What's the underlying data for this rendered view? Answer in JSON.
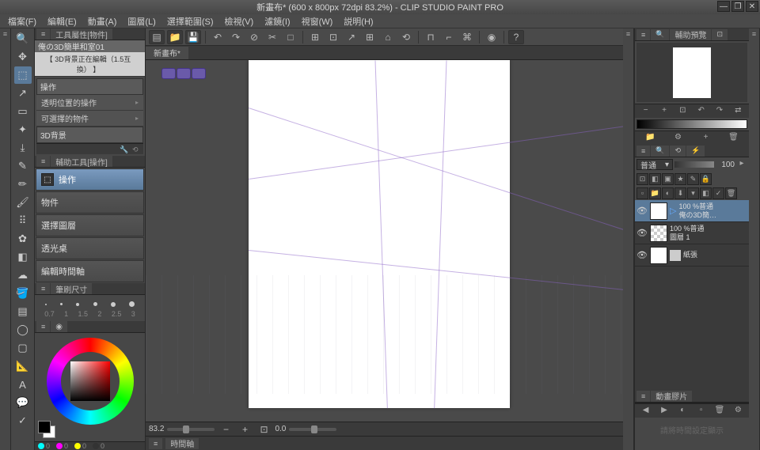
{
  "window": {
    "title": "新畫布* (600 x 800px 72dpi 83.2%)  - CLIP STUDIO PAINT PRO"
  },
  "menubar": [
    "檔案(F)",
    "編輯(E)",
    "動畫(A)",
    "圖層(L)",
    "選擇範圍(S)",
    "檢視(V)",
    "濾鏡(I)",
    "視窗(W)",
    "説明(H)"
  ],
  "toolbar_left": [
    "⊕",
    "⟳",
    "⊘",
    "✂",
    "□"
  ],
  "toolbar_mid": [
    "⊞",
    "⊡",
    "↗",
    "⊞",
    "⌂",
    "⟲"
  ],
  "toolbar_right": [
    "⊓",
    "⌐",
    "⌘",
    "◉",
    "?"
  ],
  "doc_tab": "新畫布*",
  "left": {
    "property_tabs": [
      "≡",
      "工具屬性[物件]"
    ],
    "object_name": "俺の3D簡単和室01",
    "editing_bar": "【 3D背景正在編輯（1.5互換） 】",
    "section_op": "操作",
    "op_items": [
      "透明位置的操作",
      "可選擇的物件"
    ],
    "section_3d": "3D背景",
    "subtool_tab": "輔助工具[操作]",
    "subtools": [
      {
        "label": "操作",
        "active": true
      },
      {
        "label": "物件",
        "active": false
      },
      {
        "label": "選擇圖層",
        "active": false
      },
      {
        "label": "透光桌",
        "active": false
      },
      {
        "label": "編輯時間軸",
        "active": false
      }
    ],
    "brush_tab": "筆刷尺寸",
    "brush_sizes": [
      "0.7",
      "1",
      "1.5",
      "2",
      "2.5",
      "3"
    ],
    "color_tab": "≡"
  },
  "right": {
    "nav_tab": "輔助預覽",
    "blend_mode": "普通",
    "opacity": "100",
    "layers": [
      {
        "opacity": "100 %普通",
        "name": "俺の3D簡…",
        "active": true,
        "checker": false
      },
      {
        "opacity": "100 %普通",
        "name": "圖層 1",
        "active": false,
        "checker": true
      },
      {
        "opacity": "",
        "name": "紙張",
        "active": false,
        "checker": false
      }
    ],
    "timeline_tab": "動畫膠片",
    "timeline_hint": "請將時間設定顯示"
  },
  "canvas": {
    "zoom": "83.2",
    "rotation": "0.0",
    "timeline_label": "時間軸"
  },
  "status": {
    "c": "0",
    "m": "0",
    "y": "0",
    "k": "0"
  }
}
